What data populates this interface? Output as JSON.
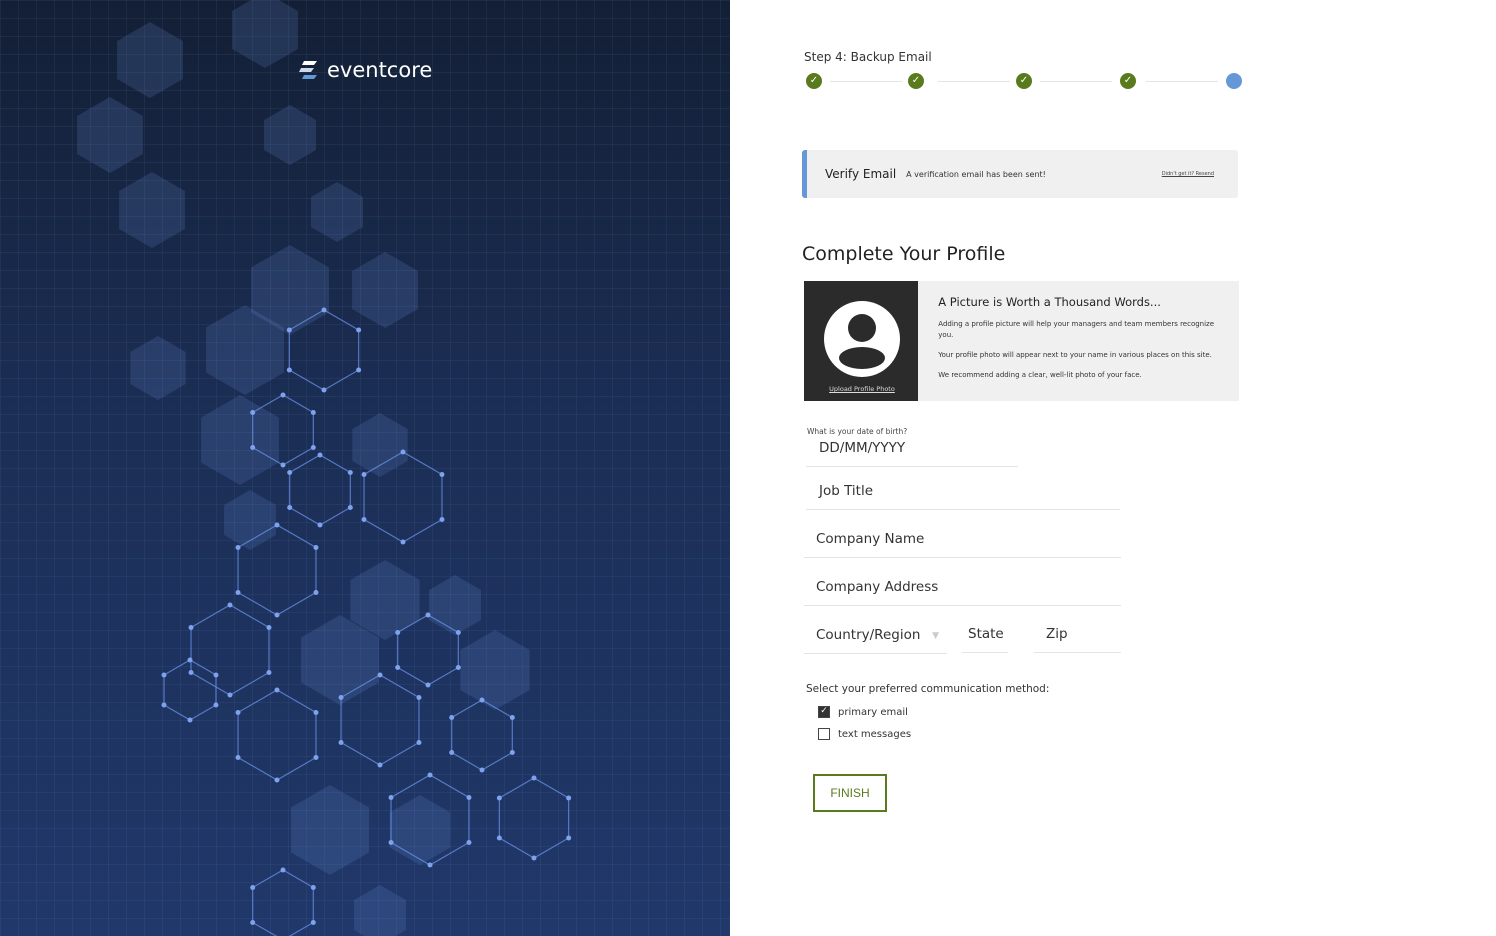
{
  "brand": {
    "name": "eventcore"
  },
  "stepper": {
    "label": "Step 4: Backup Email",
    "steps_total": 5,
    "steps_completed": 4,
    "colors": {
      "done": "#5a7a1e",
      "current": "#6598d6"
    }
  },
  "banner": {
    "title": "Verify Email",
    "message": "A verification email has been sent!",
    "resend": "Didn't get it? Resend"
  },
  "profile": {
    "title": "Complete Your Profile",
    "photo_card": {
      "upload": "Upload Profile Photo",
      "heading": "A Picture is Worth a Thousand Words...",
      "p1": "Adding a profile picture will help your managers and team members recognize you.",
      "p2": "Your profile photo will appear next to your name in various places on this site.",
      "p3": "We recommend adding a clear, well-lit photo of your face."
    },
    "dob_label": "What is your date of birth?",
    "dob_placeholder": "DD/MM/YYYY",
    "job_title": "Job Title",
    "company_name": "Company Name",
    "company_address": "Company Address",
    "country": "Country/Region",
    "state": "State",
    "zip": "Zip",
    "comm_label": "Select your preferred communication method:",
    "options": [
      {
        "label": "primary email",
        "checked": true
      },
      {
        "label": "text messages",
        "checked": false
      }
    ],
    "finish": "FINISH"
  }
}
